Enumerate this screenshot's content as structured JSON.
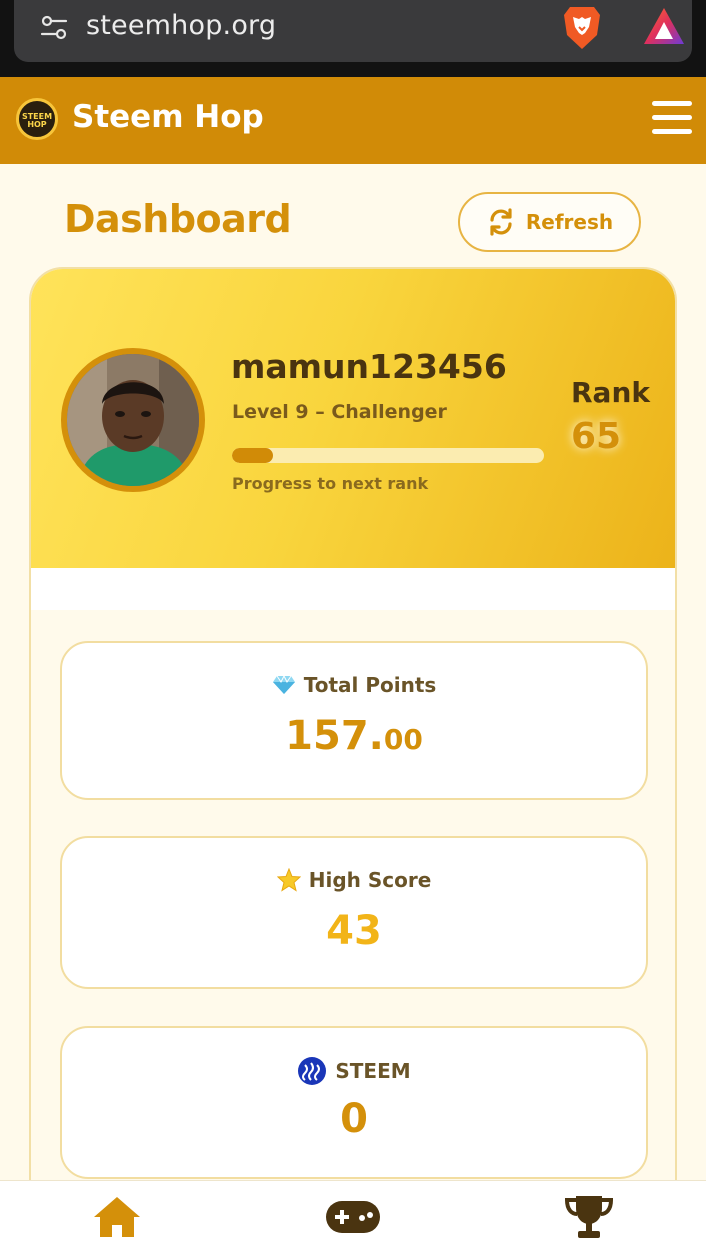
{
  "browser": {
    "url": "steemhop.org"
  },
  "header": {
    "logo_text": "STEEM HOP",
    "title": "Steem Hop"
  },
  "dashboard": {
    "title": "Dashboard",
    "refresh_label": "Refresh"
  },
  "profile": {
    "username": "mamun123456",
    "level": "Level 9 – Challenger",
    "progress_fraction": 0.13,
    "progress_label": "Progress to next rank",
    "rank_label": "Rank",
    "rank_value": "65"
  },
  "stats": {
    "total_points": {
      "icon": "gem-icon",
      "label": "Total Points",
      "value_int": "157.",
      "value_dec": "00"
    },
    "high_score": {
      "icon": "star-icon",
      "label": "High Score",
      "value": "43"
    },
    "steem": {
      "icon": "steem-logo-icon",
      "label": "STEEM",
      "value": "0"
    }
  },
  "bottom_nav": [
    {
      "name": "home",
      "icon": "home-icon"
    },
    {
      "name": "games",
      "icon": "gamepad-icon"
    },
    {
      "name": "leaderboard",
      "icon": "trophy-icon"
    }
  ],
  "colors": {
    "header": "#d18b07",
    "accent": "#d4900a",
    "background": "#fffaeb",
    "banner_start": "#ffe35a",
    "banner_end": "#ecb31a"
  }
}
